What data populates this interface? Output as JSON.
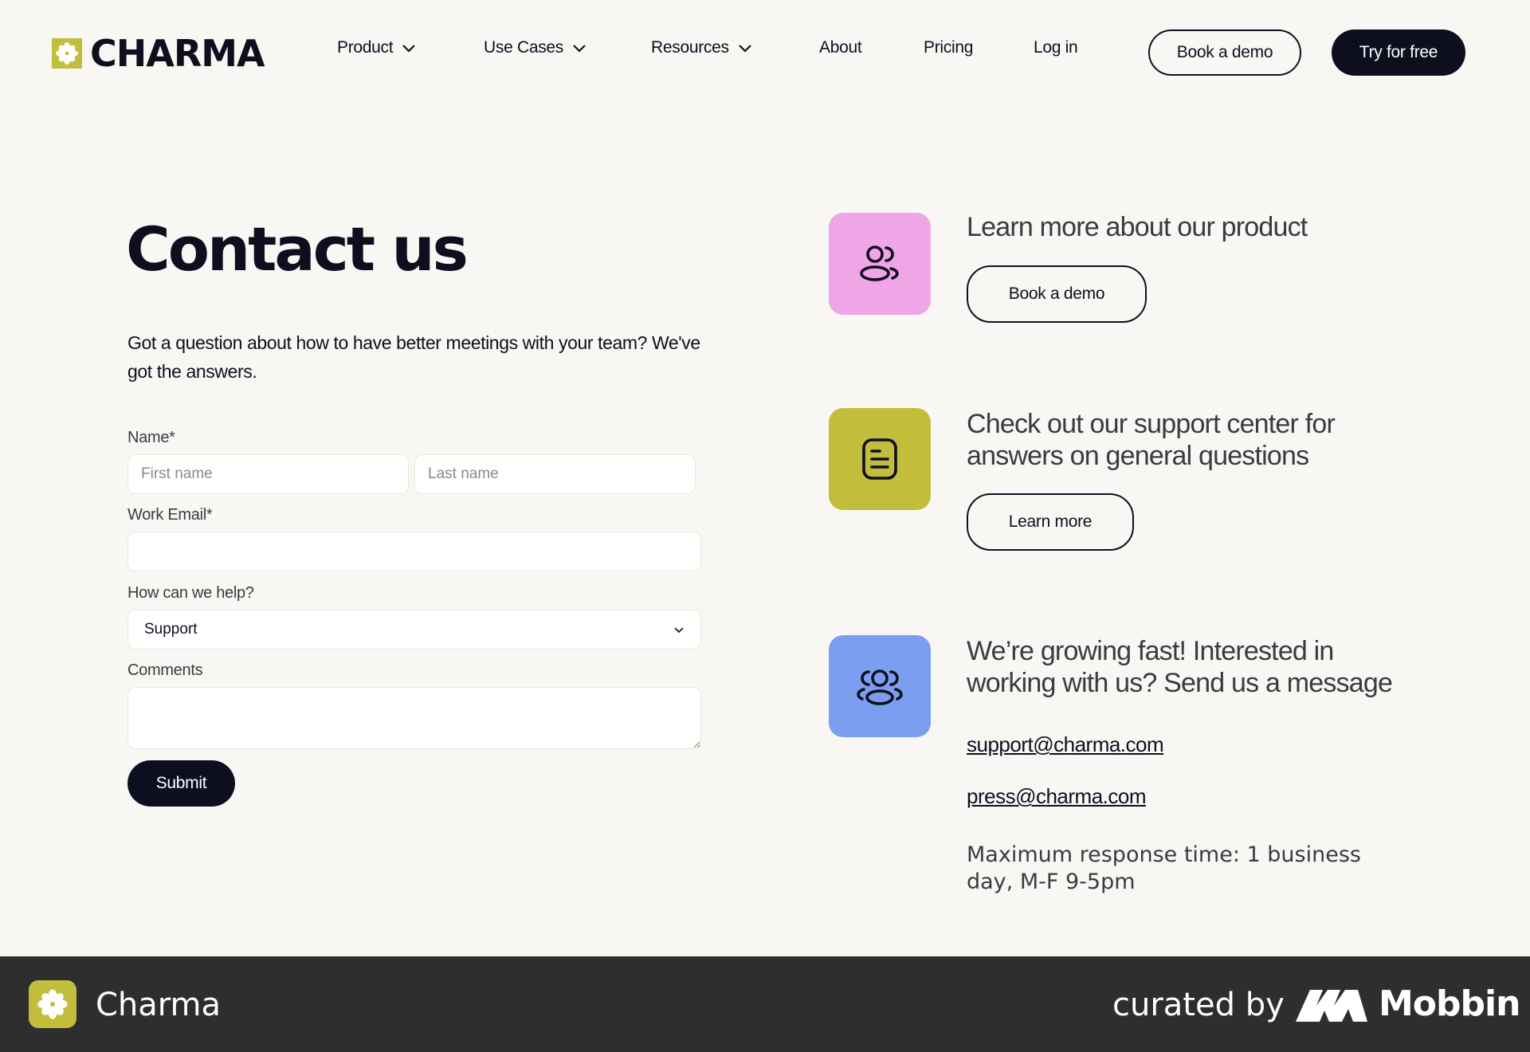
{
  "brand": {
    "name": "CHARMA",
    "accent_color": "#c2bd3b"
  },
  "nav": {
    "items": [
      {
        "label": "Product",
        "has_dropdown": true
      },
      {
        "label": "Use Cases",
        "has_dropdown": true
      },
      {
        "label": "Resources",
        "has_dropdown": true
      },
      {
        "label": "About",
        "has_dropdown": false
      },
      {
        "label": "Pricing",
        "has_dropdown": false
      },
      {
        "label": "Log in",
        "has_dropdown": false
      }
    ],
    "book_demo_label": "Book a demo",
    "try_free_label": "Try for free"
  },
  "contact": {
    "title": "Contact us",
    "intro": "Got a question about how to have better meetings with your team? We've got the answers.",
    "form": {
      "name_label": "Name*",
      "first_name_placeholder": "First name",
      "last_name_placeholder": "Last name",
      "email_label": "Work Email*",
      "email_value": "",
      "help_label": "How can we help?",
      "help_selected": "Support",
      "comments_label": "Comments",
      "comments_value": "",
      "submit_label": "Submit"
    }
  },
  "side": {
    "product": {
      "heading": "Learn more about our product",
      "button_label": "Book a demo",
      "tile_color": "#f0a6e6",
      "icon": "users-icon"
    },
    "support": {
      "heading": "Check out our support center for answers on general questions",
      "button_label": "Learn more",
      "tile_color": "#c2bd3b",
      "icon": "document-icon"
    },
    "careers": {
      "heading": "We’re growing fast! Interested in working with us? Send us a message",
      "tile_color": "#7b9ef0",
      "icon": "team-icon",
      "emails": [
        "support@charma.com",
        "press@charma.com"
      ],
      "response_time": "Maximum response time: 1 business day, M-F 9-5pm"
    }
  },
  "footer_bar": {
    "app_name": "Charma",
    "curated_by": "curated by",
    "mobbin": "Mobbin"
  }
}
